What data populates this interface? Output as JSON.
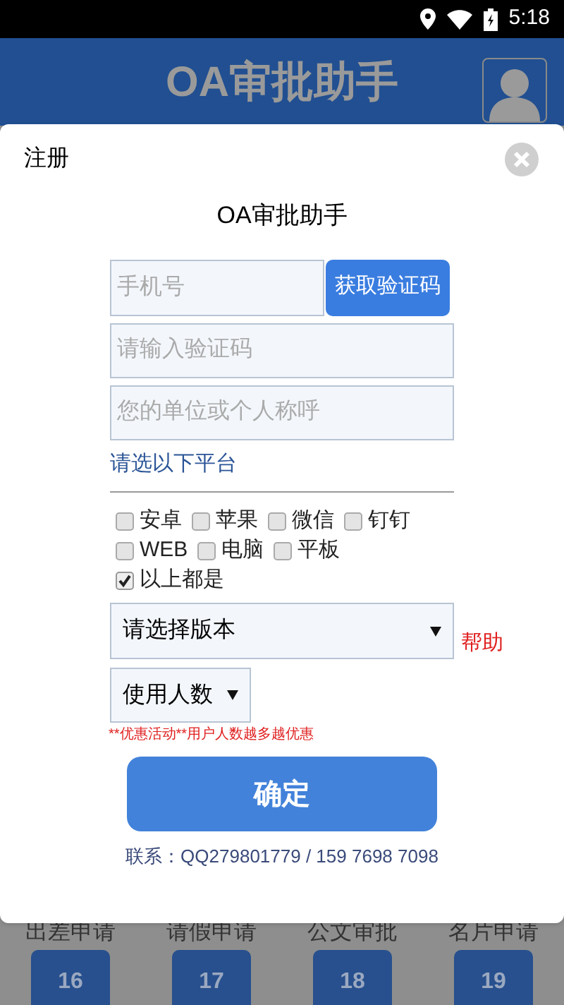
{
  "status_bar": {
    "time": "5:18"
  },
  "header": {
    "title": "OA审批助手"
  },
  "dialog": {
    "title": "注册",
    "heading": "OA审批助手",
    "phone": {
      "placeholder": "手机号"
    },
    "get_code_button": "获取验证码",
    "code": {
      "placeholder": "请输入验证码"
    },
    "name": {
      "placeholder": "您的单位或个人称呼"
    },
    "platform_label": "请选以下平台",
    "platform_rows": [
      [
        {
          "label": "安卓",
          "checked": false
        },
        {
          "label": "苹果",
          "checked": false
        },
        {
          "label": "微信",
          "checked": false
        },
        {
          "label": "钉钉",
          "checked": false
        }
      ],
      [
        {
          "label": "WEB",
          "checked": false
        },
        {
          "label": "电脑",
          "checked": false
        },
        {
          "label": "平板",
          "checked": false
        }
      ],
      [
        {
          "label": "以上都是",
          "checked": true
        }
      ]
    ],
    "version_select": {
      "value": "请选择版本"
    },
    "help_link": "帮助",
    "users_select": {
      "value": "使用人数"
    },
    "promo": "**优惠活动**用户人数越多越优惠",
    "confirm_button": "确定",
    "contact": "联系：QQ279801779 / 159 7698 7098"
  },
  "grid": [
    {
      "label": "出差申请",
      "number": "16"
    },
    {
      "label": "请假申请",
      "number": "17"
    },
    {
      "label": "公文审批",
      "number": "18"
    },
    {
      "label": "名片申请",
      "number": "19"
    }
  ]
}
